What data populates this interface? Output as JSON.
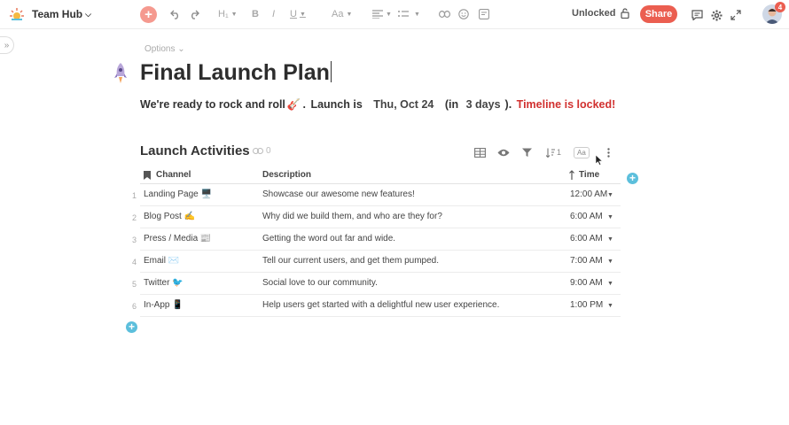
{
  "topbar": {
    "workspace": "Team Hub",
    "tools": {
      "plus": "+",
      "heading": "H₁",
      "bold": "B",
      "italic": "I",
      "underline": "U",
      "fontsize": "Aa"
    },
    "lock_label": "Unlocked",
    "share_label": "Share",
    "notification_count": "4",
    "icons": [
      "undo-icon",
      "redo-icon",
      "align-icon",
      "list-icon",
      "link-icon",
      "emoji-icon",
      "comment-icon",
      "gear-icon",
      "fullscreen-icon",
      "lock-icon"
    ]
  },
  "doc": {
    "options_label": "Options",
    "title": "Final Launch Plan",
    "subline": {
      "intro": "We're ready to rock and roll",
      "guitar": "🎸",
      "dot1": ".",
      "launch_is": "Launch is",
      "date": "Thu, Oct 24",
      "open_paren": "(in",
      "days": "3 days",
      "close_paren": ").",
      "locked": "Timeline is locked!"
    }
  },
  "table": {
    "title": "Launch Activities",
    "link_count": "0",
    "sort_count": "1",
    "aa_label": "Aa",
    "columns": {
      "channel": "Channel",
      "description": "Description",
      "time": "Time"
    },
    "rows": [
      {
        "num": "1",
        "channel": "Landing Page 🖥️",
        "description": "Showcase our awesome new features!",
        "time": "12:00 AM"
      },
      {
        "num": "2",
        "channel": "Blog Post ✍️",
        "description": "Why did we build them, and who are they for?",
        "time": "6:00 AM"
      },
      {
        "num": "3",
        "channel": "Press / Media 📰",
        "description": "Getting the word out far and wide.",
        "time": "6:00 AM"
      },
      {
        "num": "4",
        "channel": "Email ✉️",
        "description": "Tell our current users, and get them pumped.",
        "time": "7:00 AM"
      },
      {
        "num": "5",
        "channel": "Twitter 🐦",
        "description": "Social love to our community.",
        "time": "9:00 AM"
      },
      {
        "num": "6",
        "channel": "In-App 📱",
        "description": "Help users get started with a delightful new user experience.",
        "time": "1:00 PM"
      }
    ]
  },
  "colors": {
    "accent": "#eb5e50",
    "add": "#5cbfdc",
    "locked": "#d1302f"
  }
}
